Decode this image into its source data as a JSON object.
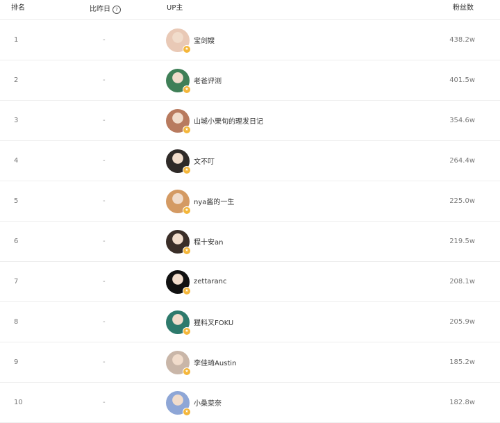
{
  "header": {
    "rank": "排名",
    "change": "比昨日",
    "up": "UP主",
    "fans": "粉丝数"
  },
  "rows": [
    {
      "rank": "1",
      "change": "-",
      "name": "宝剑嫂",
      "fans": "438.2w",
      "avatar_color": "#e9c9b6"
    },
    {
      "rank": "2",
      "change": "-",
      "name": "老爸评测",
      "fans": "401.5w",
      "avatar_color": "#3f7f57"
    },
    {
      "rank": "3",
      "change": "-",
      "name": "山城小栗旬的理发日记",
      "fans": "354.6w",
      "avatar_color": "#b87a5e"
    },
    {
      "rank": "4",
      "change": "-",
      "name": "文不叮",
      "fans": "264.4w",
      "avatar_color": "#2f2a28"
    },
    {
      "rank": "5",
      "change": "-",
      "name": "nya酱的一生",
      "fans": "225.0w",
      "avatar_color": "#d49a63"
    },
    {
      "rank": "6",
      "change": "-",
      "name": "程十安an",
      "fans": "219.5w",
      "avatar_color": "#3a2e28"
    },
    {
      "rank": "7",
      "change": "-",
      "name": "zettaranc",
      "fans": "208.1w",
      "avatar_color": "#111111"
    },
    {
      "rank": "8",
      "change": "-",
      "name": "猩料叉FOKU",
      "fans": "205.9w",
      "avatar_color": "#2e7a6c"
    },
    {
      "rank": "9",
      "change": "-",
      "name": "李佳琦Austin",
      "fans": "185.2w",
      "avatar_color": "#c9b6a8"
    },
    {
      "rank": "10",
      "change": "-",
      "name": "小桑菜奈",
      "fans": "182.8w",
      "avatar_color": "#8ea6d6"
    }
  ]
}
